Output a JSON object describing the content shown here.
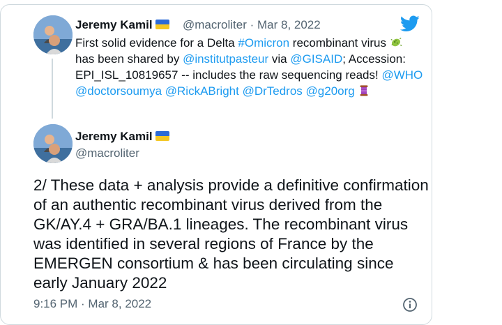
{
  "tweet1": {
    "name": "Jeremy Kamil",
    "handle": "@macroliter",
    "sep": " · ",
    "date": "Mar 8, 2022",
    "text_1": "First solid evidence for a Delta ",
    "hashtag": "#Omicron",
    "text_2": " recombinant virus ",
    "emoji_virus": "microbe-emoji",
    "text_3": " has been shared by ",
    "mention_pasteur": "@institutpasteur",
    "text_4": " via ",
    "mention_gisaid": "@GISAID",
    "text_5": "; Accession: EPI_ISL_10819657 -- includes the raw sequencing reads! ",
    "mention_who": "@WHO",
    "mention_soumya": "@doctorsoumya",
    "mention_rick": "@RickABright",
    "mention_tedros": "@DrTedros",
    "mention_g20": "@g20org",
    "emoji_thread": "thread-spool-emoji"
  },
  "tweet2": {
    "name": "Jeremy Kamil",
    "handle": "@macroliter",
    "text": "2/ These data + analysis provide a definitive confirmation of an authentic recombinant virus derived from the GK/AY.4 + GRA/BA.1 lineages. The recombinant virus was identified in several regions of France by the EMERGEN consortium & has been circulating since early January 2022",
    "timestamp": "9:16 PM · Mar 8, 2022"
  },
  "icons": {
    "logo": "twitter-bird-icon",
    "info": "info-icon",
    "flag": "ukraine-flag-emoji"
  },
  "colors": {
    "link": "#1d9bf0",
    "text": "#0f1419",
    "secondary": "#536471",
    "border": "#cfd9de"
  }
}
